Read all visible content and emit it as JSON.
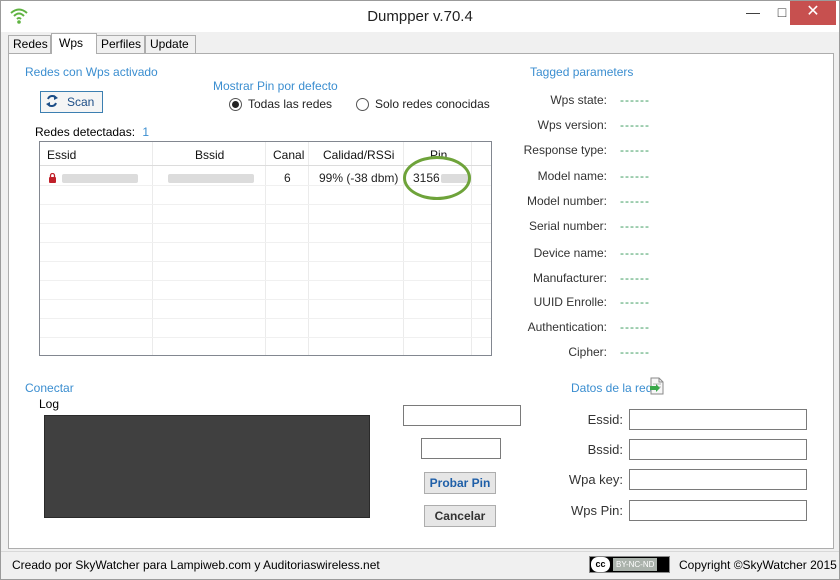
{
  "window": {
    "title": "Dumpper v.70.4"
  },
  "tabs": [
    {
      "label": "Redes"
    },
    {
      "label": "Wps"
    },
    {
      "label": "Perfiles"
    },
    {
      "label": "Update"
    }
  ],
  "wps": {
    "section_title": "Redes con Wps activado",
    "scan_label": "Scan",
    "pin_group": {
      "title": "Mostrar Pin por defecto",
      "options": [
        {
          "label": "Todas las redes",
          "selected": true
        },
        {
          "label": "Solo redes conocidas",
          "selected": false
        }
      ]
    },
    "detected_label": "Redes detectadas:",
    "detected_count": "1",
    "table": {
      "headers": [
        "Essid",
        "Bssid",
        "Canal",
        "Calidad/RSSi",
        "Pin"
      ],
      "rows": [
        {
          "essid": "",
          "bssid": "",
          "canal": "6",
          "calidad": "99% (-38 dbm)",
          "pin": "3156"
        }
      ]
    }
  },
  "tagged": {
    "title": "Tagged parameters",
    "params": [
      {
        "label": "Wps state:",
        "value": "------"
      },
      {
        "label": "Wps version:",
        "value": "------"
      },
      {
        "label": "Response type:",
        "value": "------"
      },
      {
        "label": "Model name:",
        "value": "------"
      },
      {
        "label": "Model number:",
        "value": "------"
      },
      {
        "label": "Serial number:",
        "value": "------"
      },
      {
        "label": "Device name:",
        "value": "------"
      },
      {
        "label": "Manufacturer:",
        "value": "------"
      },
      {
        "label": "UUID Enrolle:",
        "value": "------"
      },
      {
        "label": "Authentication:",
        "value": "------"
      },
      {
        "label": "Cipher:",
        "value": "------"
      }
    ]
  },
  "conectar": {
    "title": "Conectar",
    "log_label": "Log",
    "probar_label": "Probar Pin",
    "cancelar_label": "Cancelar"
  },
  "datos": {
    "title": "Datos de la red",
    "fields": [
      {
        "label": "Essid:",
        "value": ""
      },
      {
        "label": "Bssid:",
        "value": ""
      },
      {
        "label": "Wpa key:",
        "value": ""
      },
      {
        "label": "Wps Pin:",
        "value": ""
      }
    ]
  },
  "status": {
    "credit": "Creado por SkyWatcher para Lampiweb.com y Auditoriaswireless.net",
    "license_badge": "BY-NC-ND",
    "copyright": "Copyright ©SkyWatcher 2015"
  },
  "colors": {
    "accent": "#3b8ed0",
    "param_value": "#3a9a5c",
    "highlight_ring": "#6ea33a",
    "close": "#c7504f"
  }
}
